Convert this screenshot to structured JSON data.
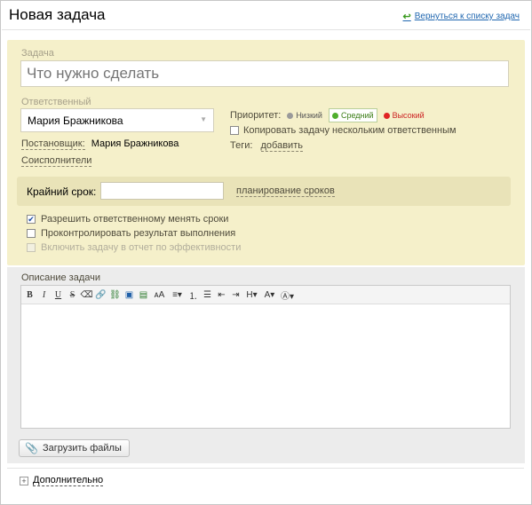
{
  "header": {
    "title": "Новая задача",
    "back_link": "Вернуться к списку задач"
  },
  "task": {
    "title_label": "Задача",
    "title_placeholder": "Что нужно сделать",
    "responsible_label": "Ответственный",
    "responsible_value": "Мария Бражникова",
    "creator_label": "Постановщик:",
    "creator_value": "Мария Бражникова",
    "coexecutors_label": "Соисполнители",
    "priority": {
      "label": "Приоритет:",
      "options": [
        "Низкий",
        "Средний",
        "Высокий"
      ],
      "selected": "Средний",
      "colors": {
        "low": "#9a9a9a",
        "medium": "#4fae2e",
        "high": "#e02424"
      }
    },
    "copy_label": "Копировать задачу нескольким ответственным",
    "copy_checked": false,
    "tags_label": "Теги:",
    "tags_add": "добавить",
    "deadline_label": "Крайний срок:",
    "deadline_value": "",
    "planning_link": "планирование сроков",
    "options": [
      {
        "label": "Разрешить ответственному менять сроки",
        "checked": true,
        "disabled": false
      },
      {
        "label": "Проконтролировать результат выполнения",
        "checked": false,
        "disabled": false
      },
      {
        "label": "Включить задачу в отчет по эффективности",
        "checked": false,
        "disabled": true
      }
    ]
  },
  "description": {
    "label": "Описание задачи",
    "toolbar_icons": [
      "bold-icon",
      "italic-icon",
      "underline-icon",
      "strikethrough-icon",
      "eraser-icon",
      "link-icon",
      "unlink-icon",
      "image-icon",
      "video-icon",
      "font-format-icon",
      "align-icon",
      "ordered-list-icon",
      "bullet-list-icon",
      "outdent-icon",
      "indent-icon",
      "heading-icon",
      "font-size-icon",
      "font-color-icon"
    ]
  },
  "upload_button": "Загрузить файлы",
  "extra_label": "Дополнительно",
  "colors": {
    "main_bg": "#f5f0ca",
    "deadline_bg": "#e9e3b8",
    "desc_bg": "#ececec",
    "link": "#2067b0"
  }
}
